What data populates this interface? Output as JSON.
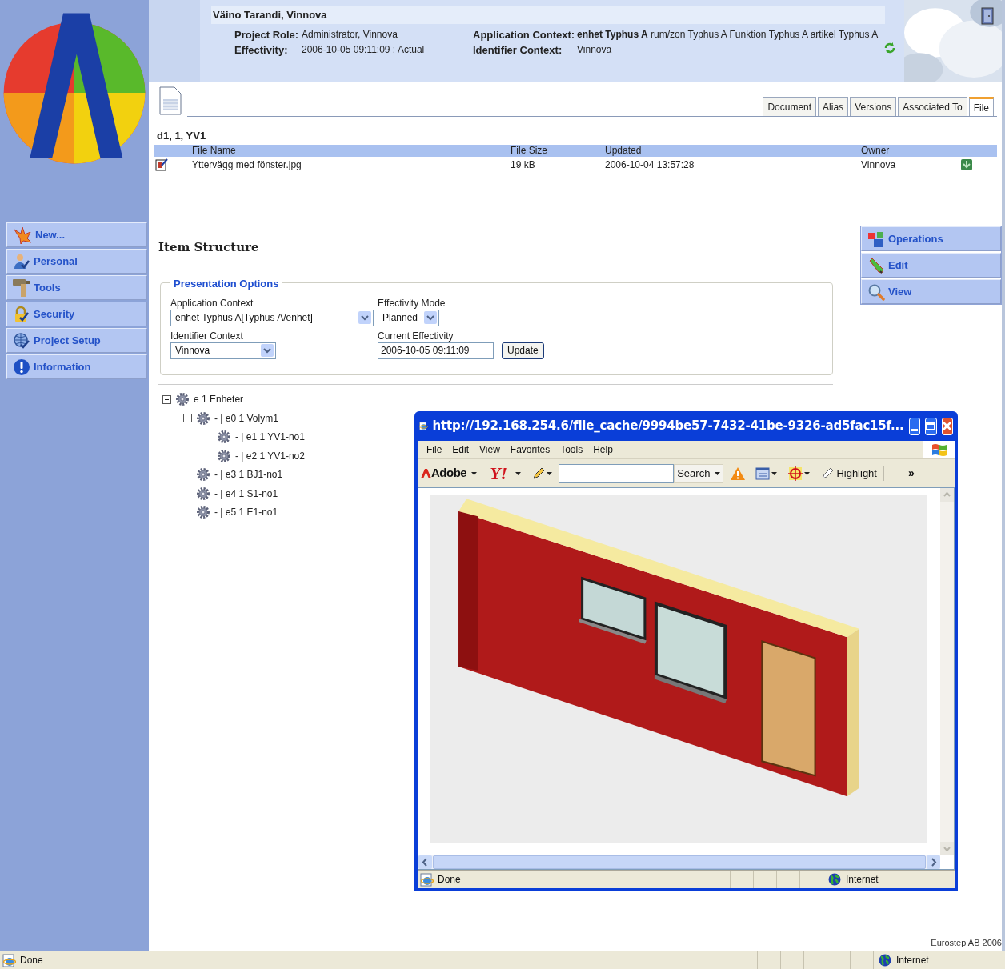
{
  "header": {
    "user": "Väino Tarandi, Vinnova",
    "fields": [
      {
        "label": "Project Role:",
        "value": "Administrator, Vinnova"
      },
      {
        "label": "Application Context:",
        "value": "**enhet Typhus A** rum/zon Typhus A Funktion Typhus A artikel Typhus A"
      },
      {
        "label": "Effectivity:",
        "value": "2006-10-05 09:11:09 : Actual"
      },
      {
        "label": "Identifier Context:",
        "value": "Vinnova"
      }
    ]
  },
  "tabs": [
    {
      "label": "Document",
      "selected": false
    },
    {
      "label": "Alias",
      "selected": false
    },
    {
      "label": "Versions",
      "selected": false
    },
    {
      "label": "Associated To",
      "selected": false
    },
    {
      "label": "File",
      "selected": true
    }
  ],
  "document": {
    "title": "d1, 1, YV1",
    "columns": [
      "File Name",
      "File Size",
      "Updated",
      "Owner"
    ],
    "rows": [
      {
        "cells": [
          "Yttervägg med fönster.jpg",
          "19 kB",
          "2006-10-04 13:57:28",
          "Vinnova"
        ]
      }
    ]
  },
  "left_menu": [
    {
      "label": "New..."
    },
    {
      "label": "Personal"
    },
    {
      "label": "Tools"
    },
    {
      "label": "Security"
    },
    {
      "label": "Project Setup"
    },
    {
      "label": "Information"
    }
  ],
  "right_menu": [
    {
      "label": "Operations"
    },
    {
      "label": "Edit"
    },
    {
      "label": "View"
    }
  ],
  "item_structure": {
    "title": "Item Structure",
    "options_title": "Presentation Options",
    "application_context": {
      "label": "Application Context",
      "value": "enhet Typhus A[Typhus A/enhet]"
    },
    "effectivity_mode": {
      "label": "Effectivity Mode",
      "value": "Planned"
    },
    "identifier_context": {
      "label": "Identifier Context",
      "value": "Vinnova"
    },
    "current_effectivity": {
      "label": "Current Effectivity",
      "value": "2006-10-05 09:11:09"
    },
    "update_button": "Update",
    "tree": [
      {
        "label": "e 1 Enheter",
        "expanded": true,
        "children": [
          {
            "label": "- | e0 1 Volym1",
            "expanded": true,
            "children": [
              {
                "label": "- | e1 1 YV1-no1"
              },
              {
                "label": "- | e2 1 YV1-no2"
              }
            ]
          },
          {
            "label": "- | e3 1 BJ1-no1"
          },
          {
            "label": "- | e4 1 S1-no1"
          },
          {
            "label": "- | e5 1 E1-no1"
          }
        ]
      }
    ]
  },
  "popup": {
    "title": "http://192.168.254.6/file_cache/9994be57-7432-41be-9326-ad5fac15f...",
    "menu": [
      "File",
      "Edit",
      "View",
      "Favorites",
      "Tools",
      "Help"
    ],
    "toolbar": {
      "adobe": "Adobe",
      "yahoo": "Y!",
      "search_button": "Search",
      "highlight": "Highlight",
      "more": "»"
    },
    "status": {
      "text": "Done",
      "zone": "Internet"
    }
  },
  "footer": "Eurostep AB 2006",
  "status_bar": {
    "text": "Done",
    "zone": "Internet"
  }
}
